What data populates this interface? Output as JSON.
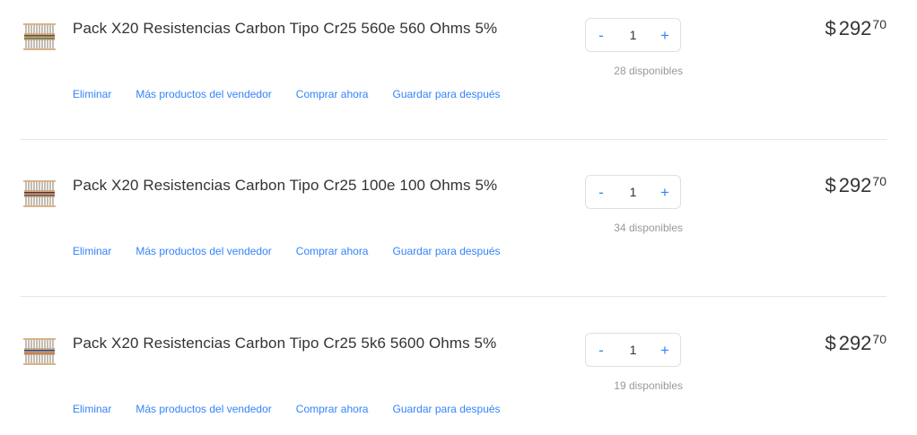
{
  "items": [
    {
      "title": "Pack X20 Resistencias Carbon Tipo Cr25 560e 560 Ohms 5%",
      "actions": [
        "Eliminar",
        "Más productos del vendedor",
        "Comprar ahora",
        "Guardar para después"
      ],
      "quantity": "1",
      "stock": "28 disponibles",
      "price": {
        "symbol": "$",
        "integer": "292",
        "cents": "70"
      },
      "minus": "-",
      "plus": "+"
    },
    {
      "title": "Pack X20 Resistencias Carbon Tipo Cr25 100e 100 Ohms 5%",
      "actions": [
        "Eliminar",
        "Más productos del vendedor",
        "Comprar ahora",
        "Guardar para después"
      ],
      "quantity": "1",
      "stock": "34 disponibles",
      "price": {
        "symbol": "$",
        "integer": "292",
        "cents": "70"
      },
      "minus": "-",
      "plus": "+"
    },
    {
      "title": "Pack X20 Resistencias Carbon Tipo Cr25 5k6 5600 Ohms 5%",
      "actions": [
        "Eliminar",
        "Más productos del vendedor",
        "Comprar ahora",
        "Guardar para después"
      ],
      "quantity": "1",
      "stock": "19 disponibles",
      "price": {
        "symbol": "$",
        "integer": "292",
        "cents": "70"
      },
      "minus": "-",
      "plus": "+"
    }
  ],
  "colors": {
    "accent": "#3483fa",
    "text": "#333333",
    "muted": "#999999",
    "divider": "#e6e6e6"
  },
  "icons": {
    "thumbnail": "resistor-pack-thumbnail"
  }
}
